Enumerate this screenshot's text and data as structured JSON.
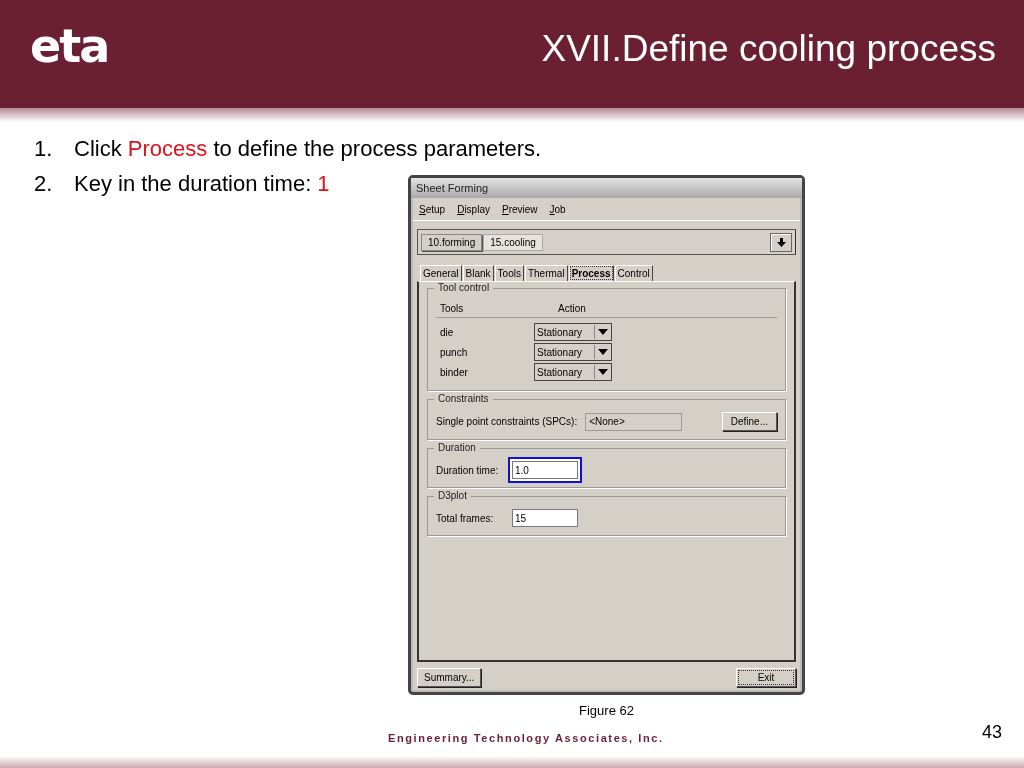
{
  "header": {
    "logo": "eta",
    "title": "XVII.Define cooling process"
  },
  "steps": [
    {
      "number": "1.",
      "parts": [
        {
          "text": "Click ",
          "highlight": false
        },
        {
          "text": "Process",
          "highlight": true
        },
        {
          "text": " to define the process parameters.",
          "highlight": false
        }
      ]
    },
    {
      "number": "2.",
      "parts": [
        {
          "text": "Key in the duration time: ",
          "highlight": false
        },
        {
          "text": "1",
          "highlight": true
        }
      ]
    }
  ],
  "dialog": {
    "title": "Sheet Forming",
    "menu": [
      "Setup",
      "Display",
      "Preview",
      "Job"
    ],
    "stages": [
      {
        "label": "10.forming",
        "selected": false
      },
      {
        "label": "15.cooling",
        "selected": true
      }
    ],
    "tabs": [
      {
        "label": "General",
        "selected": false
      },
      {
        "label": "Blank",
        "selected": false
      },
      {
        "label": "Tools",
        "selected": false
      },
      {
        "label": "Thermal",
        "selected": false
      },
      {
        "label": "Process",
        "selected": true
      },
      {
        "label": "Control",
        "selected": false
      }
    ],
    "tool_control": {
      "title": "Tool control",
      "columns": [
        "Tools",
        "Action"
      ],
      "rows": [
        {
          "tool": "die",
          "action": "Stationary"
        },
        {
          "tool": "punch",
          "action": "Stationary"
        },
        {
          "tool": "binder",
          "action": "Stationary"
        }
      ]
    },
    "constraints": {
      "title": "Constraints",
      "label": "Single point constraints (SPCs):",
      "value": "<None>",
      "button": "Define..."
    },
    "duration": {
      "title": "Duration",
      "label": "Duration time:",
      "value": "1.0",
      "highlighted": true
    },
    "d3plot": {
      "title": "D3plot",
      "label": "Total frames:",
      "value": "15",
      "highlighted": false
    },
    "buttons": [
      {
        "label": "Summary...",
        "focused": false
      },
      {
        "label": "Exit",
        "focused": true
      }
    ]
  },
  "caption": "Figure 62",
  "footer": {
    "company": "Engineering Technology Associates, Inc.",
    "page": "43"
  }
}
